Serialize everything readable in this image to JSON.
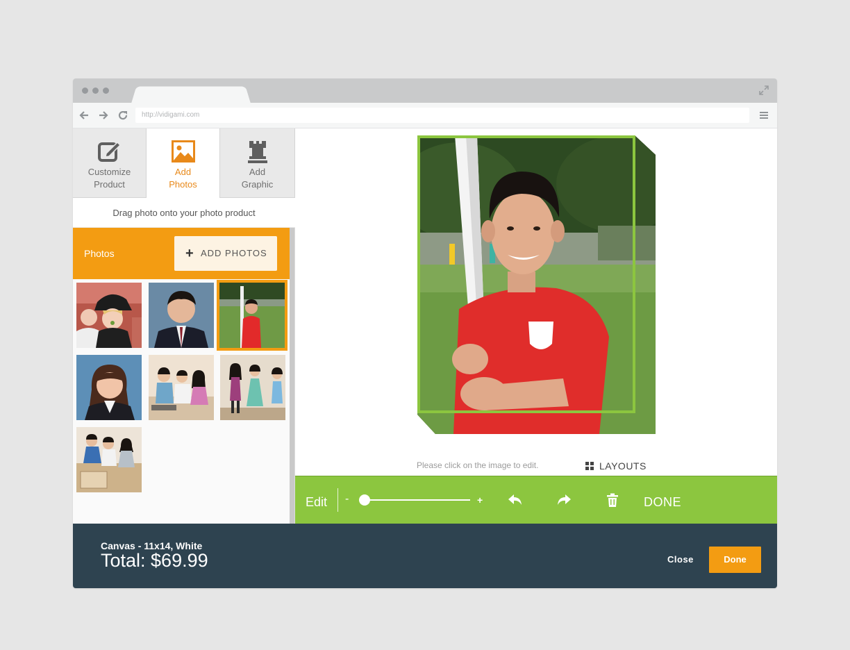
{
  "browser": {
    "url": "http://vidigami.com"
  },
  "panel": {
    "tabs": [
      {
        "line1": "Customize",
        "line2": "Product",
        "icon": "edit-icon"
      },
      {
        "line1": "Add",
        "line2": "Photos",
        "icon": "image-icon"
      },
      {
        "line1": "Add",
        "line2": "Graphic",
        "icon": "rook-icon"
      }
    ],
    "hint": "Drag photo onto your photo product",
    "photos_label": "Photos",
    "add_photos_label": "ADD PHOTOS"
  },
  "canvas": {
    "edit_hint": "Please click on the image to edit.",
    "layouts_label": "LAYOUTS"
  },
  "toolbar": {
    "edit_label": "Edit",
    "minus": "-",
    "plus": "+",
    "zoom_level": 0.0,
    "done_label": "DONE"
  },
  "footer": {
    "product": "Canvas - 11x14, White",
    "total": "Total: $69.99",
    "close_label": "Close",
    "done_label": "Done"
  },
  "colors": {
    "accent_orange": "#f39c12",
    "accent_green": "#8cc63f",
    "footer_bg": "#2e4350"
  }
}
